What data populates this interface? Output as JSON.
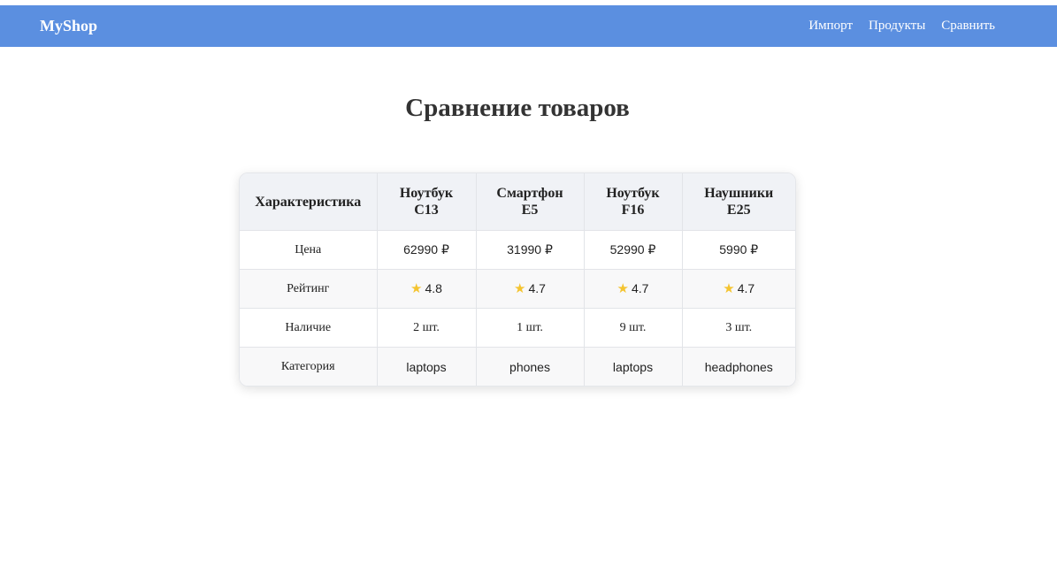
{
  "header": {
    "brand": "MyShop",
    "nav": [
      "Импорт",
      "Продукты",
      "Сравнить"
    ]
  },
  "page": {
    "title": "Сравнение товаров"
  },
  "table": {
    "corner": "Характеристика",
    "products": [
      {
        "line1": "Ноутбук",
        "line2": "C13"
      },
      {
        "line1": "Смартфон",
        "line2": "E5"
      },
      {
        "line1": "Ноутбук",
        "line2": "F16"
      },
      {
        "line1": "Наушники",
        "line2": "E25"
      }
    ],
    "rows": [
      {
        "label": "Цена",
        "values": [
          "62990 ₽",
          "31990 ₽",
          "52990 ₽",
          "5990 ₽"
        ]
      },
      {
        "label": "Рейтинг",
        "values": [
          "4.8",
          "4.7",
          "4.7",
          "4.7"
        ]
      },
      {
        "label": "Наличие",
        "values": [
          "2 шт.",
          "1 шт.",
          "9 шт.",
          "3 шт."
        ]
      },
      {
        "label": "Категория",
        "values": [
          "laptops",
          "phones",
          "laptops",
          "headphones"
        ]
      }
    ],
    "rating_icon": "star-icon"
  },
  "colors": {
    "navbar": "#5b8fe0",
    "star": "#f4c430",
    "header_row": "#f0f2f6"
  }
}
